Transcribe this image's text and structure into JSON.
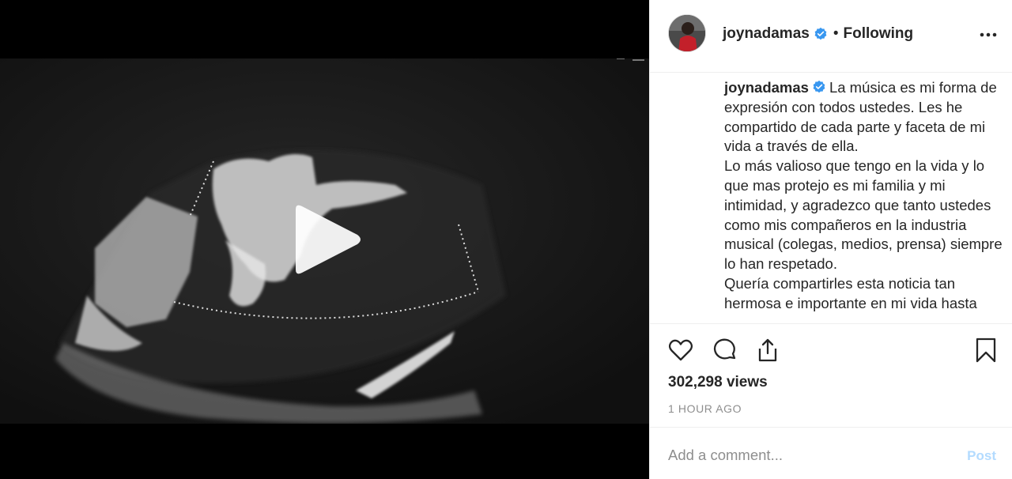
{
  "post": {
    "username": "joynadamas",
    "follow_status": "Following",
    "separator": "•",
    "caption": {
      "username": "joynadamas",
      "text": "La música es mi forma de expresión con todos ustedes. Les he compartido de cada parte y faceta de mi vida a través de ella.\nLo más valioso que tengo en la vida y lo que mas protejo es mi familia y mi intimidad, y agradezco que tanto ustedes como mis compañeros en la industria musical (colegas, medios, prensa) siempre lo han respetado.\nQuería compartirles esta noticia tan hermosa e importante en mi vida hasta"
    },
    "views": "302,298 views",
    "timestamp": "1 HOUR AGO"
  },
  "comment": {
    "placeholder": "Add a comment...",
    "post_label": "Post"
  },
  "icons": {
    "verified": "verified-badge-icon",
    "more": "more-options-icon",
    "like": "heart-icon",
    "comment": "comment-bubble-icon",
    "share": "share-icon",
    "save": "bookmark-icon",
    "play": "play-icon"
  },
  "colors": {
    "verified_blue": "#3897f0",
    "post_disabled": "#b3dbff",
    "muted_text": "#8e8e8e",
    "divider": "#efefef"
  }
}
